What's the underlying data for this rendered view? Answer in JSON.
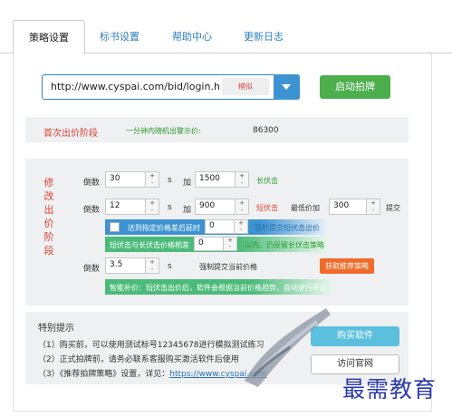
{
  "tabs": [
    {
      "label": "策略设置",
      "active": true
    },
    {
      "label": "标书设置",
      "active": false
    },
    {
      "label": "帮助中心",
      "active": false
    },
    {
      "label": "更新日志",
      "active": false
    }
  ],
  "url_bar": {
    "value": "http://www.cyspai.com/bid/login.h",
    "sim_label": "模拟"
  },
  "start_button": "启动拍牌",
  "first_stage": {
    "label": "首次出价阶段",
    "desc": "一分钟内随机出警示价:",
    "value": "86300"
  },
  "modify_stage": {
    "label_chars": [
      "修",
      "改",
      "出",
      "价",
      "阶",
      "段"
    ],
    "row1": {
      "countdown_label": "倒数",
      "countdown": "30",
      "unit": "s",
      "add_label": "加",
      "add": "1500",
      "tag": "长伏击"
    },
    "row2": {
      "countdown_label": "倒数",
      "countdown": "12",
      "unit": "s",
      "add_label": "加",
      "add": "900",
      "tag": "短伏击",
      "min_label": "最低价加",
      "min_add": "300",
      "submit_label": "提交"
    },
    "blue_bar": {
      "text": "达到指定价格差后延时",
      "value": "0",
      "after": "毫秒提交短伏击出价"
    },
    "green_bar": {
      "text": "短伏击与长伏击价格相差",
      "value": "0",
      "after": "以内，仍促留长伏击策略"
    },
    "row3": {
      "countdown_label": "倒数",
      "countdown": "3.5",
      "unit": "s",
      "force_label": "强制提交当前价格"
    },
    "strategy_button": "获取推荐策略",
    "smart_note": "智能补价：短伏击出价后，软件会根据当前价格趋势，自动进行补价"
  },
  "notes": {
    "title": "特别提示",
    "line1": "（1）购买前，可以使用测试标号12345678进行模拟测试练习",
    "line2": "（2）正式拍牌前，请务必联系客服购买激活软件后使用",
    "line3_prefix": "（3）《推荐拍牌策略》设置，详见：",
    "line3_link": "https://www.cyspai.com"
  },
  "buy_button": "购买软件",
  "visit_button": "访问官网",
  "watermark": "最需教育",
  "colors": {
    "accent_blue": "#3d93d1",
    "green_button": "#4cae4c",
    "stage_red": "#e0402f",
    "orange": "#f06a2a"
  }
}
